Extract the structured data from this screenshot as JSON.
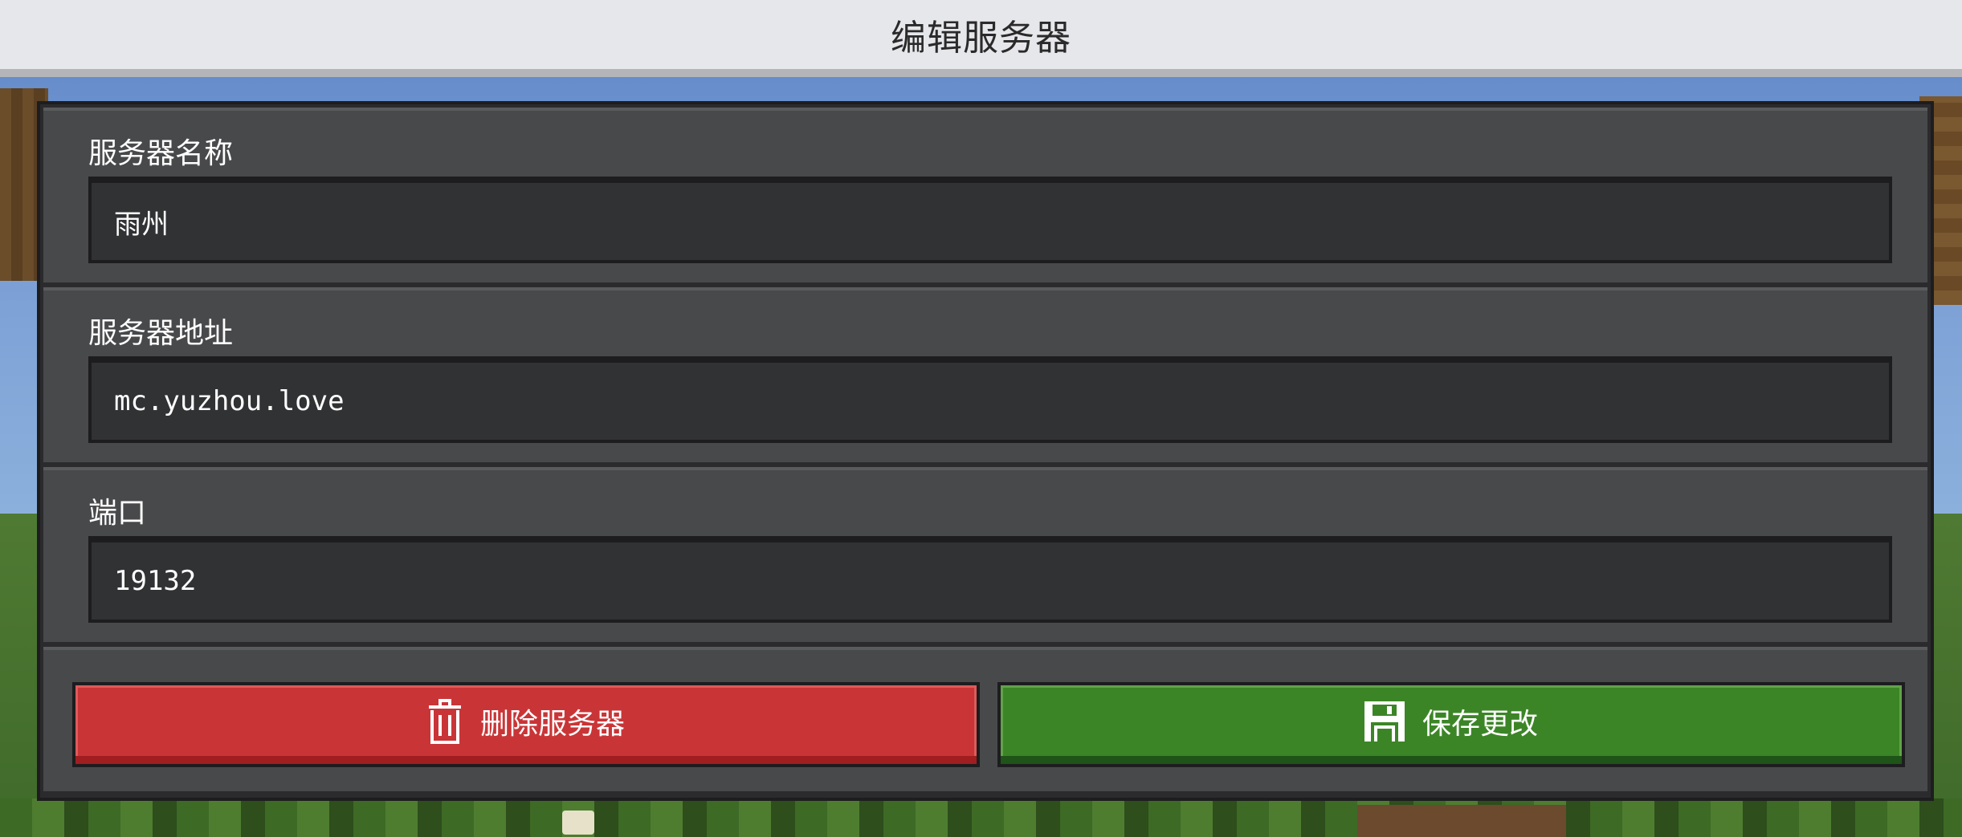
{
  "window": {
    "title": "编辑服务器"
  },
  "form": {
    "server_name": {
      "label": "服务器名称",
      "value": "雨州"
    },
    "server_address": {
      "label": "服务器地址",
      "value": "mc.yuzhou.love"
    },
    "port": {
      "label": "端口",
      "value": "19132"
    }
  },
  "actions": {
    "delete": {
      "label": "删除服务器",
      "icon": "trash-icon",
      "color": "#c93537"
    },
    "save": {
      "label": "保存更改",
      "icon": "floppy-disk-icon",
      "color": "#3c8527"
    }
  }
}
